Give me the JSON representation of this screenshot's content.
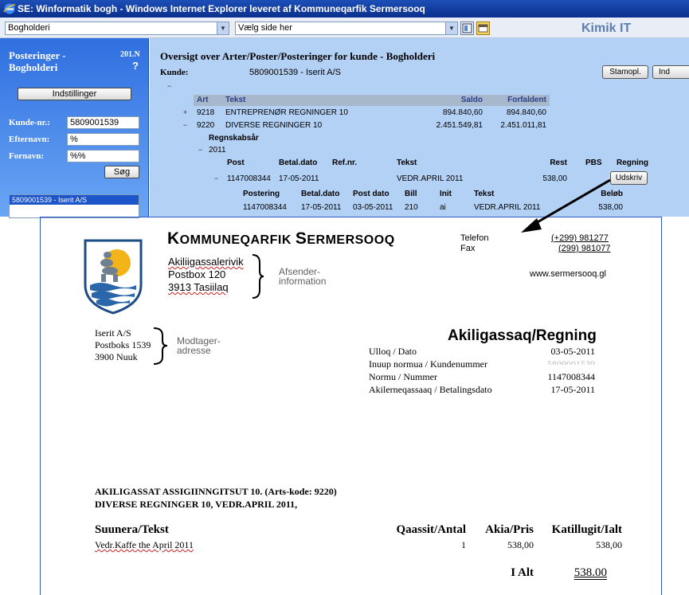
{
  "window": {
    "title": "SE: Winformatik  bogh  - Windows Internet Explorer leveret af Kommuneqarfik Sermersooq"
  },
  "toolbar": {
    "module_select": "Bogholderi",
    "page_select": "Vælg side her",
    "brand": "Kimik IT"
  },
  "sidebar": {
    "title_line1": "Posteringer -",
    "title_line2": "Bogholderi",
    "version": "201.N",
    "help": "?",
    "settings_button": "Indstillinger",
    "customer_no_label": "Kunde-nr.:",
    "customer_no_value": "5809001539",
    "lastname_label": "Efternavn:",
    "lastname_value": "%",
    "firstname_label": "Fornavn:",
    "firstname_value": "%%",
    "search_button": "Søg",
    "results": [
      "5809001539 - Iserit  A/S"
    ]
  },
  "main": {
    "heading": "Oversigt over Arter/Poster/Posteringer for kunde - Bogholderi",
    "customer_label": "Kunde:",
    "customer_value": "5809001539 - Iserit A/S",
    "buttons": {
      "stamopl": "Stamopl.",
      "ind": "Ind"
    },
    "art_headers": {
      "art": "Art",
      "tekst": "Tekst",
      "saldo": "Saldo",
      "forfaldent": "Forfaldent"
    },
    "art_rows": [
      {
        "toggle": "+",
        "art": "9218",
        "tekst": "ENTREPRENØR REGNINGER 10",
        "saldo": "894.840,60",
        "forfaldent": "894.840,60"
      },
      {
        "toggle": "−",
        "art": "9220",
        "tekst": "DIVERSE REGNINGER 10",
        "saldo": "2.451.549,81",
        "forfaldent": "2.451.011,81"
      }
    ],
    "year_label": "Regnskabsår",
    "year": "2011",
    "post_headers": {
      "post": "Post",
      "betal": "Betal.dato",
      "ref": "Ref.nr.",
      "tekst": "Tekst",
      "rest": "Rest",
      "pbs": "PBS",
      "regning": "Regning"
    },
    "post_row": {
      "post": "1147008344",
      "betal": "17-05-2011",
      "tekst": "VEDR.APRIL 2011",
      "rest": "538,00",
      "button": "Udskriv"
    },
    "postering_headers": {
      "postering": "Postering",
      "betal": "Betal.dato",
      "postdato": "Post dato",
      "bill": "Bill",
      "init": "Init",
      "tekst": "Tekst",
      "belob": "Beløb"
    },
    "postering_row": {
      "postering": "1147008344",
      "betal": "17-05-2011",
      "postdato": "03-05-2011",
      "bill": "210",
      "init": "ai",
      "tekst": "VEDR.APRIL 2011",
      "belob": "538,00"
    }
  },
  "invoice": {
    "company_first_cap": "K",
    "company_rest1": "OMMUNEQARFIK ",
    "company_second_cap": "S",
    "company_rest2": "ERMERSOOQ",
    "sender": [
      "Akiliigassalerivik",
      "Postbox 120",
      "3913 Tasiilaq"
    ],
    "sender_note_line1": "Afsender-",
    "sender_note_line2": "information",
    "phone_label": "Telefon",
    "phone_value": "(+299) 981277",
    "fax_label": "Fax",
    "fax_value": "(299) 981077",
    "website": "www.sermersooq.gl",
    "recipient": [
      "Iserit  A/S",
      "Postboks 1539",
      "3900 Nuuk"
    ],
    "recipient_note_line1": "Modtager-",
    "recipient_note_line2": "adresse",
    "doc_title": "Akiligassaq/Regning",
    "info": [
      {
        "label": "Ulloq / Dato",
        "value": "03-05-2011"
      },
      {
        "label": "Inuup normua / Kundenummer",
        "value": "5809001539"
      },
      {
        "label": "Normu / Nummer",
        "value": "1147008344"
      },
      {
        "label": "Akilerneqassaaq / Betalingsdato",
        "value": "17-05-2011"
      }
    ],
    "subject_line1": "AKILIGASSAT ASSIGIINNGITSUT  10. (Arts-kode:  9220)",
    "subject_line2": "DIVERSE REGNINGER 10,  VEDR.APRIL  2011,",
    "lines_headers": {
      "tekst": "Suunera/Tekst",
      "antal": "Qaassit/Antal",
      "pris": "Akia/Pris",
      "ialt": "Katillugit/Ialt"
    },
    "lines": [
      {
        "tekst": "Vedr.Kaffe the April 2011",
        "antal": "1",
        "pris": "538,00",
        "ialt": "538,00"
      }
    ],
    "total_label": "I Alt",
    "total_value": "538.00"
  },
  "colors": {
    "titlebar": "#0a2f8c",
    "sidebar": "#2f6fe0",
    "main_bg": "#b3d0f5",
    "doc_border": "#2b5ac8"
  }
}
